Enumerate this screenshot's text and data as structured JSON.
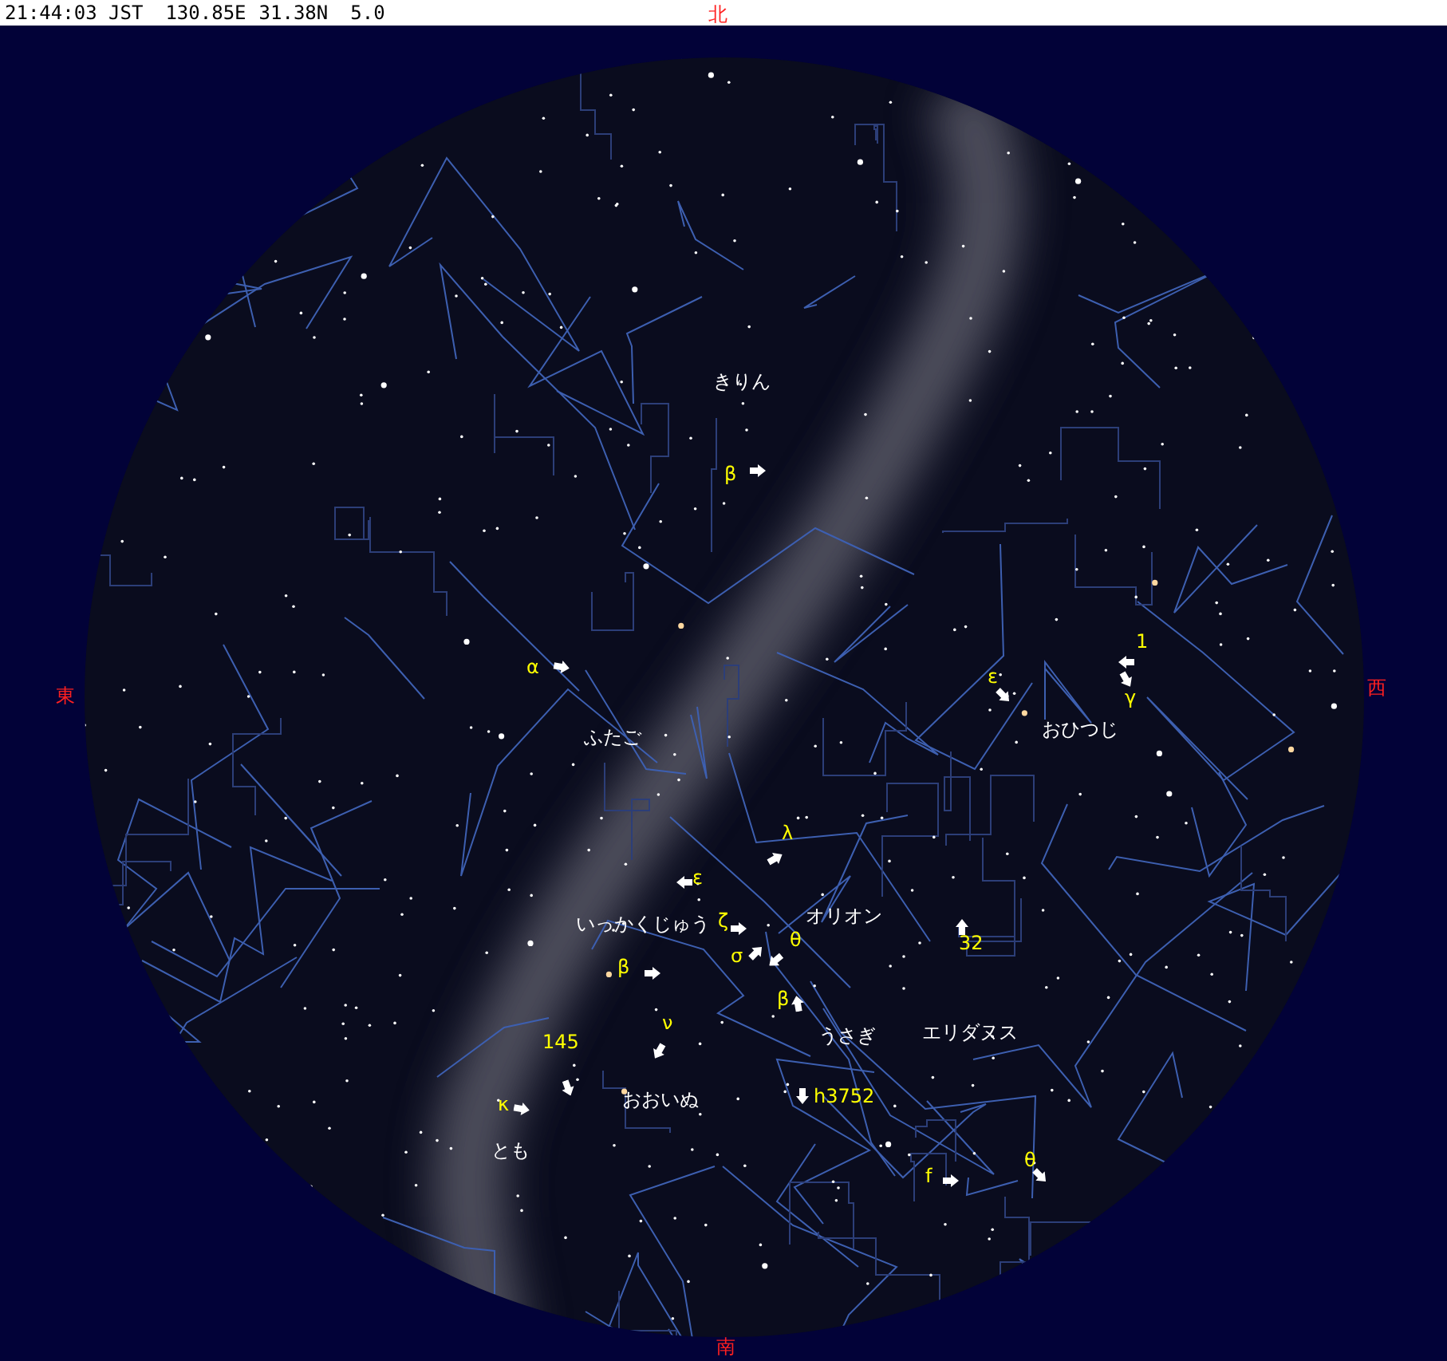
{
  "status_bar": {
    "time": "21:44:03 JST",
    "longitude": "130.85E",
    "latitude": "31.38N",
    "limiting_magnitude": "5.0"
  },
  "directions": [
    {
      "kind": "north",
      "label": "北"
    },
    {
      "kind": "east",
      "label": "東"
    },
    {
      "kind": "west",
      "label": "西"
    },
    {
      "kind": "south",
      "label": "南"
    }
  ],
  "constellations": [
    "きりん",
    "ふたご",
    "いっかくじゅう",
    "オリオン",
    "おひつじ",
    "うさぎ",
    "エリダヌス",
    "おおいぬ",
    "とも"
  ],
  "star_labels": [
    "β",
    "α",
    "ε",
    "1",
    "γ",
    "ε",
    "λ",
    "ζ",
    "σ",
    "θ",
    "β",
    "β",
    "145",
    "ν",
    "κ",
    "h3752",
    "32",
    "f",
    "θ"
  ]
}
